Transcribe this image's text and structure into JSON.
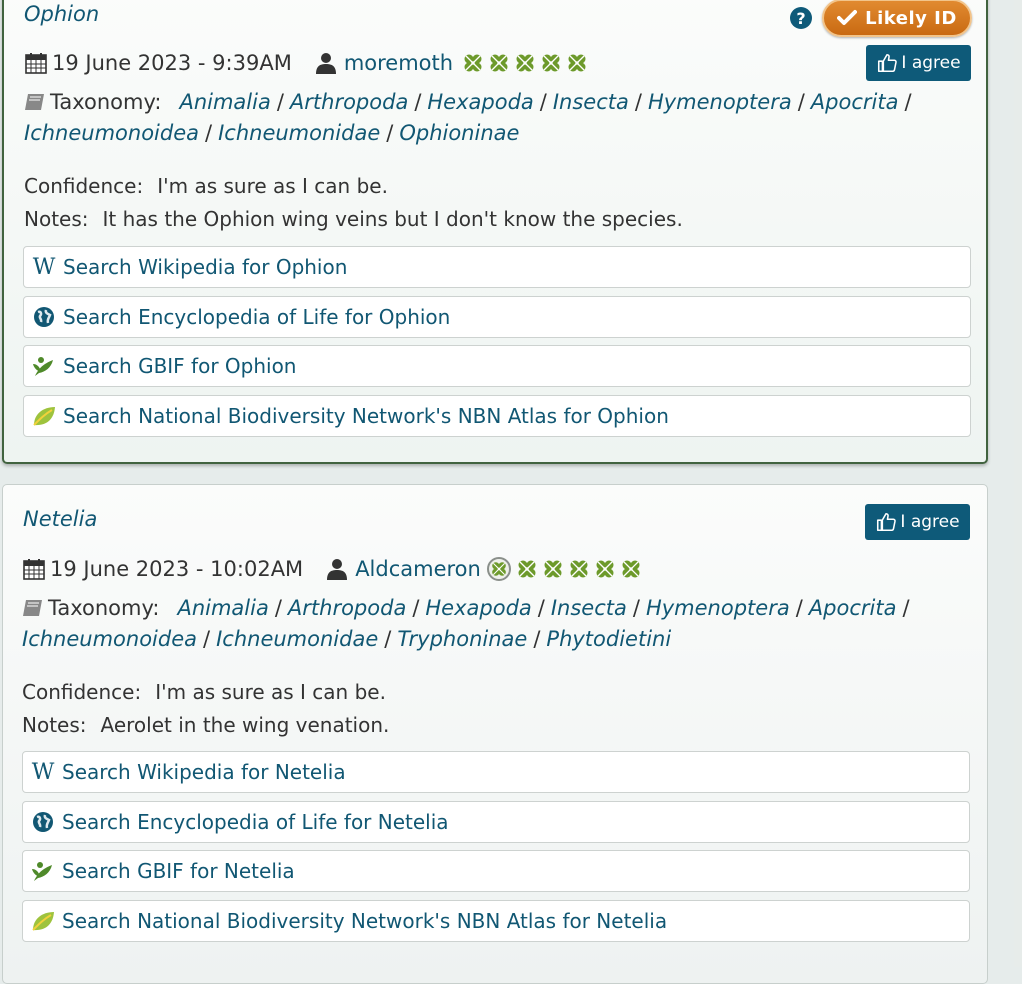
{
  "cards": [
    {
      "species": "Ophion",
      "date": "19 June 2023 - 9:39AM",
      "user": "moremoth",
      "clovers": 5,
      "clover_ring": false,
      "likely_label": "Likely ID",
      "help_label": "?",
      "agree_label": "I agree",
      "taxonomy_label": "Taxonomy:",
      "taxonomy": [
        "Animalia",
        "Arthropoda",
        "Hexapoda",
        "Insecta",
        "Hymenoptera",
        "Apocrita",
        "Ichneumonoidea",
        "Ichneumonidae",
        "Ophioninae"
      ],
      "confidence_label": "Confidence:",
      "confidence": "I'm as sure as I can be.",
      "notes_label": "Notes:",
      "notes": "It has the Ophion wing veins but I don't know the species.",
      "searches": [
        {
          "icon": "wikipedia-icon",
          "label": "Search Wikipedia for Ophion"
        },
        {
          "icon": "globe-icon",
          "label": "Search Encyclopedia of Life for Ophion"
        },
        {
          "icon": "gbif-icon",
          "label": "Search GBIF for Ophion"
        },
        {
          "icon": "nbn-icon",
          "label": "Search National Biodiversity Network's NBN Atlas for Ophion"
        }
      ]
    },
    {
      "species": "Netelia",
      "date": "19 June 2023 - 10:02AM",
      "user": "Aldcameron",
      "clovers": 5,
      "clover_ring": true,
      "agree_label": "I agree",
      "taxonomy_label": "Taxonomy:",
      "taxonomy": [
        "Animalia",
        "Arthropoda",
        "Hexapoda",
        "Insecta",
        "Hymenoptera",
        "Apocrita",
        "Ichneumonoidea",
        "Ichneumonidae",
        "Tryphoninae",
        "Phytodietini"
      ],
      "confidence_label": "Confidence:",
      "confidence": "I'm as sure as I can be.",
      "notes_label": "Notes:",
      "notes": "Aerolet in the wing venation.",
      "searches": [
        {
          "icon": "wikipedia-icon",
          "label": "Search Wikipedia for Netelia"
        },
        {
          "icon": "globe-icon",
          "label": "Search Encyclopedia of Life for Netelia"
        },
        {
          "icon": "gbif-icon",
          "label": "Search GBIF for Netelia"
        },
        {
          "icon": "nbn-icon",
          "label": "Search National Biodiversity Network's NBN Atlas for Netelia"
        }
      ]
    }
  ],
  "colors": {
    "link": "#115773",
    "button": "#0e5a79",
    "likely": "#d57a20",
    "clover": "#6d9a2b"
  }
}
